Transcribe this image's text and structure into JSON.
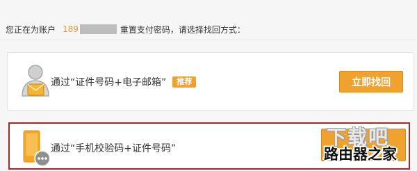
{
  "header": {
    "prefix": "您正在为账户",
    "account_visible": "189",
    "suffix": "重置支付密码，请选择找回方式："
  },
  "options": [
    {
      "icon": "person-envelope-icon",
      "label": "通过“证件号码+电子邮箱”",
      "badge": "推荐",
      "button_label": "立即找回"
    },
    {
      "icon": "phone-message-icon",
      "label": "通过“手机校验码+证件号码”",
      "selected": true
    }
  ],
  "watermark": {
    "top": "下载吧",
    "bottom": "路由器之家"
  },
  "colors": {
    "accent": "#f0a22e",
    "accent_dark": "#dc8a16",
    "highlight_border": "#a8282a",
    "account_number": "#e39b2e"
  }
}
